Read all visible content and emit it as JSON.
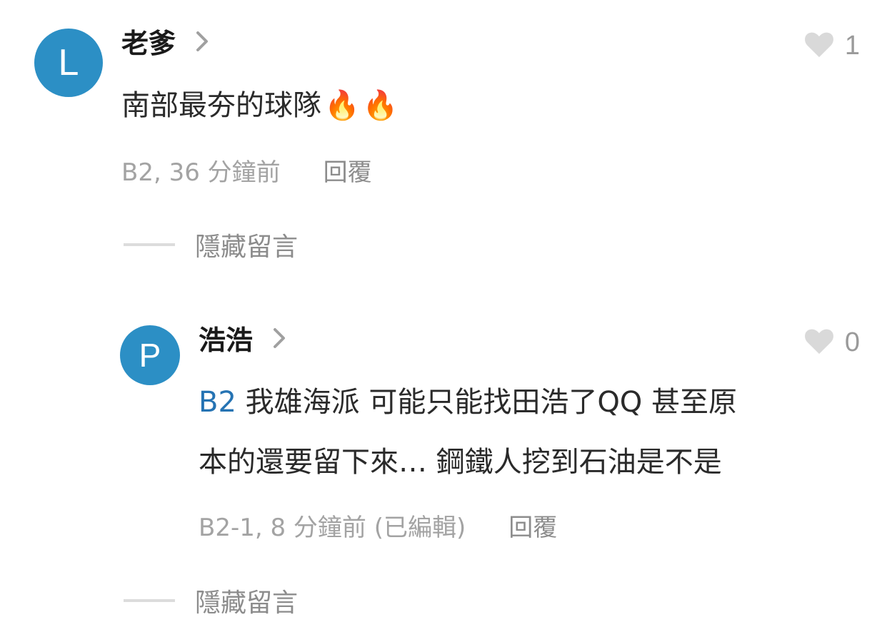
{
  "comments": [
    {
      "avatar_letter": "L",
      "username": "老爹",
      "like_count": "1",
      "text": "南部最夯的球隊",
      "emoji": "🔥🔥",
      "meta": "B2, 36 分鐘前",
      "reply_label": "回覆",
      "hide_label": "隱藏留言"
    },
    {
      "avatar_letter": "P",
      "username": "浩浩",
      "like_count": "0",
      "mention": "B2",
      "text_line1": " 我雄海派 可能只能找田浩了QQ 甚至原",
      "text_line2": "本的還要留下來… 鋼鐵人挖到石油是不是",
      "meta": "B2-1, 8 分鐘前 (已編輯)",
      "reply_label": "回覆",
      "hide_label": "隱藏留言"
    }
  ],
  "colors": {
    "avatar": "#2c8fc5",
    "mention": "#2573b3",
    "muted": "#a3a3a3"
  },
  "icons": {
    "chevron": "chevron-right-icon",
    "like": "heart-icon",
    "emoji": "fire-emoji"
  }
}
